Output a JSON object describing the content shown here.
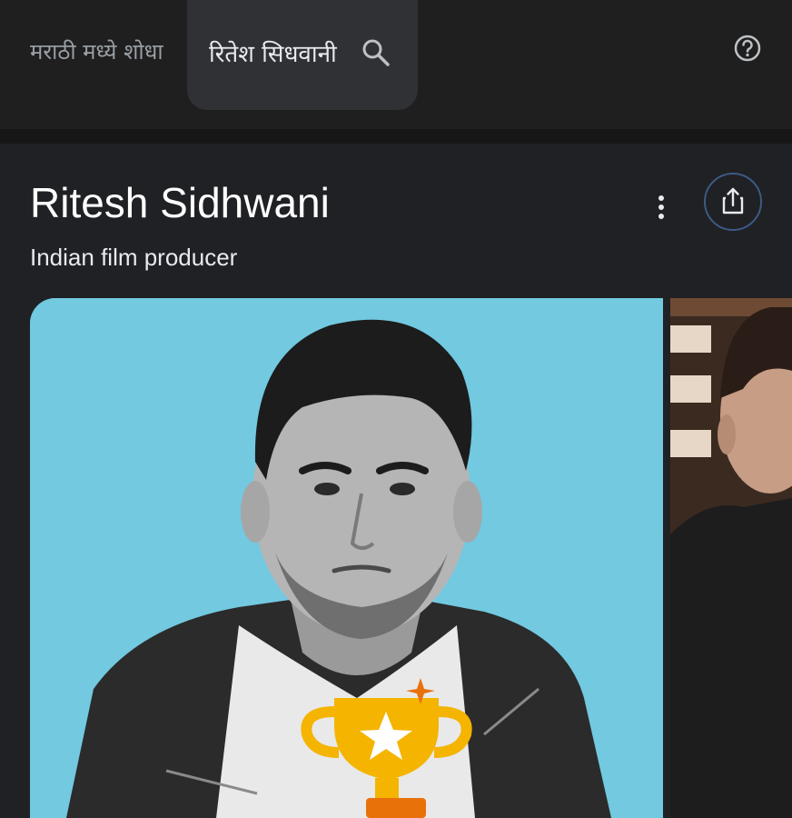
{
  "header": {
    "language_tab_label": "मराठी मध्ये शोधा",
    "search_query": "रितेश सिधवानी",
    "icons": {
      "search": "search-icon",
      "help": "help-circle-icon"
    }
  },
  "entity": {
    "title": "Ritesh Sidhwani",
    "subtitle": "Indian film producer",
    "icons": {
      "more": "more-vert-icon",
      "share": "share-icon"
    }
  },
  "images": {
    "main_photo": "portrait-photo",
    "badge": "trophy-icon",
    "second_photo": "portrait-photo-2"
  },
  "colors": {
    "background": "#1f1f1f",
    "panel": "#202124",
    "chip": "#303134",
    "photo_bg": "#72c9e0",
    "trophy": "#f4b400",
    "share_border": "#3c5a86"
  }
}
